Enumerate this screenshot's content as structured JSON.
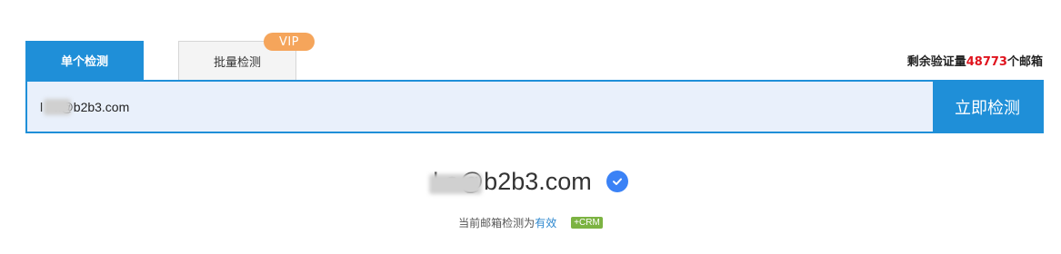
{
  "tabs": {
    "single_label": "单个检测",
    "batch_label": "批量检测",
    "vip_badge": "VIP"
  },
  "quota": {
    "prefix": "剩余验证量",
    "count": "48773",
    "suffix": "个邮箱"
  },
  "search": {
    "value": "l   a@b2b3.com",
    "button_label": "立即检测"
  },
  "result": {
    "email": "l      a@b2b3.com",
    "status_prefix": "当前邮箱检测为",
    "status_value": "有效",
    "crm_badge": "+CRM"
  },
  "colors": {
    "accent": "#1f8fd8",
    "vip": "#f5a55b",
    "quota_number": "#e0141e",
    "verified": "#3b82f6",
    "crm": "#7cb342"
  }
}
